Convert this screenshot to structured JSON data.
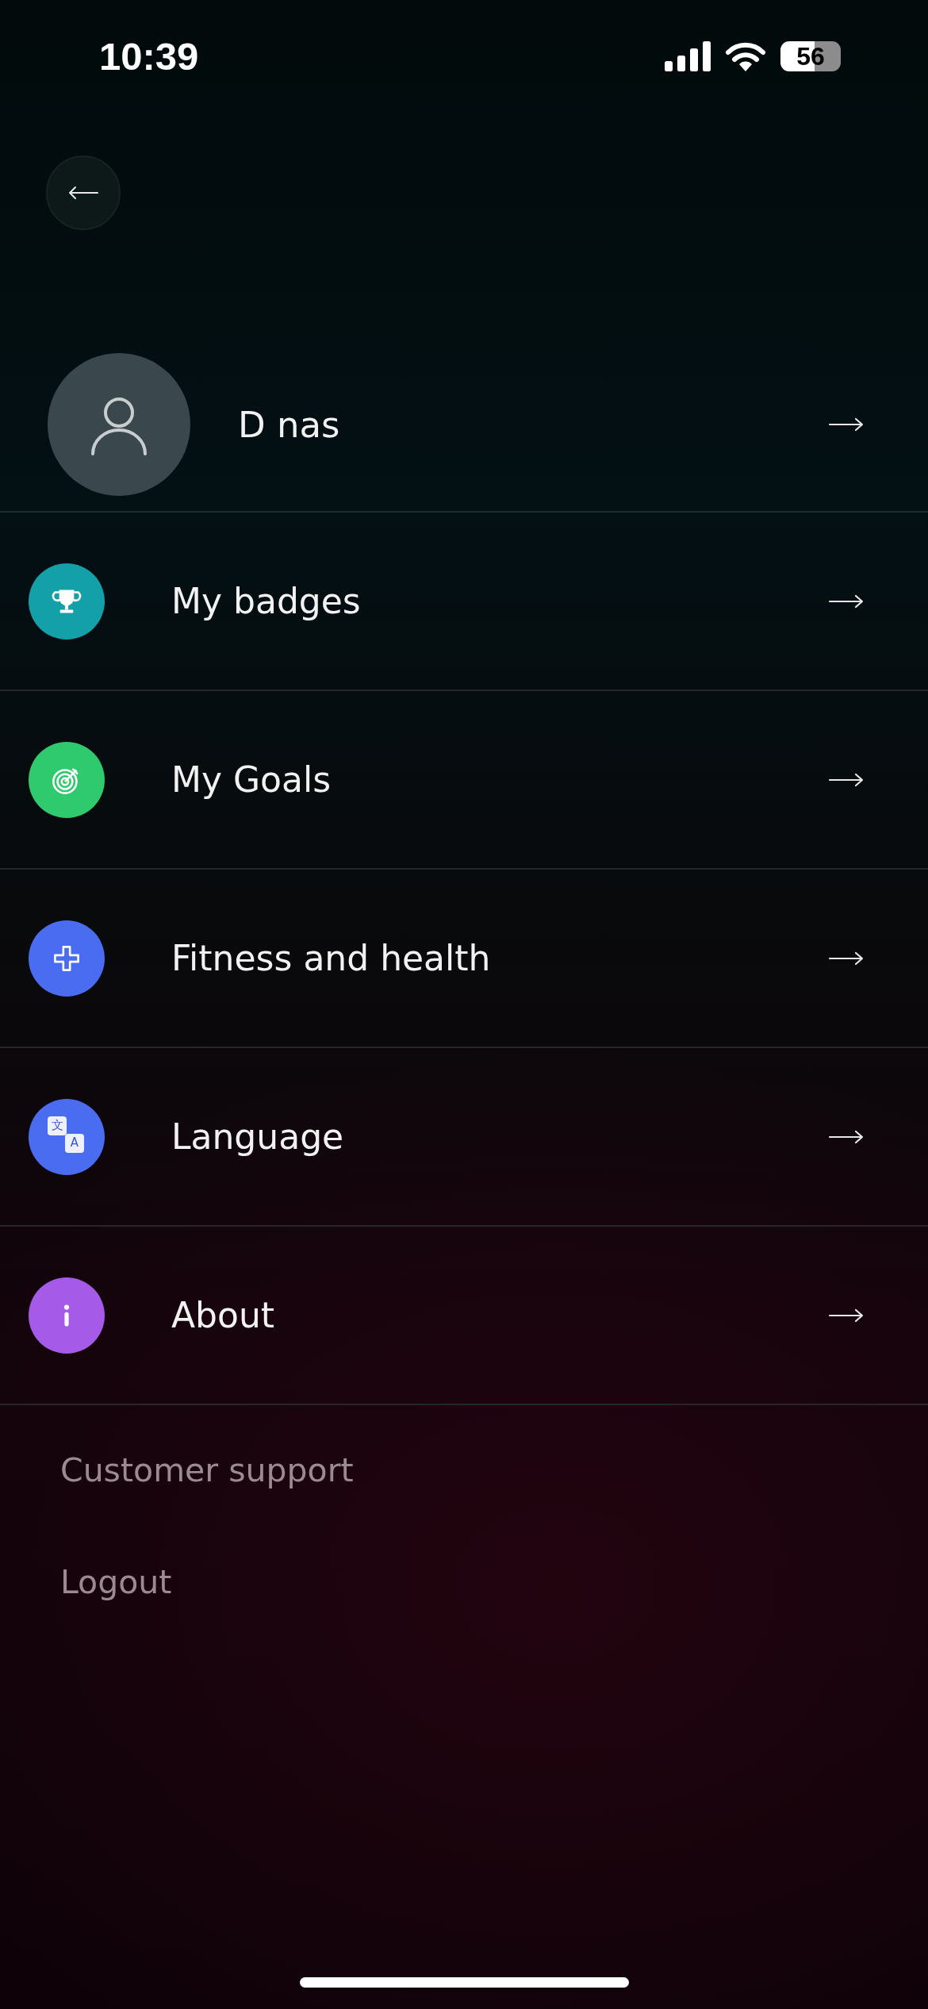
{
  "status_bar": {
    "time": "10:39",
    "battery": "56"
  },
  "profile": {
    "name": "D nas"
  },
  "menu": [
    {
      "label": "My badges",
      "kind": "trophy",
      "color": "#13a0a8"
    },
    {
      "label": "My Goals",
      "kind": "target",
      "color": "#2fc96e"
    },
    {
      "label": "Fitness and health",
      "kind": "cross",
      "color": "#4a6cf0"
    },
    {
      "label": "Language",
      "kind": "translate",
      "color": "#4a6cf0",
      "glyphs": [
        "文",
        "A"
      ]
    },
    {
      "label": "About",
      "kind": "info",
      "color": "#a65ae8"
    }
  ],
  "links": [
    "Customer support",
    "Logout"
  ]
}
